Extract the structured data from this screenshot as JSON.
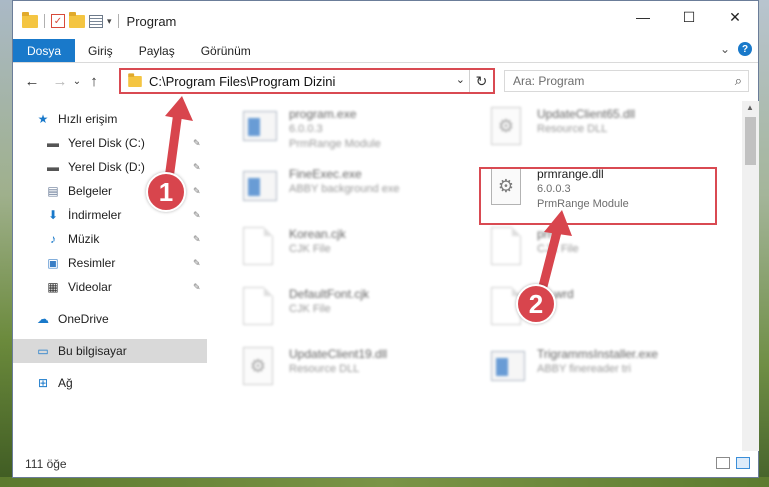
{
  "window": {
    "title": "Program",
    "min_glyph": "—",
    "max_glyph": "☐",
    "close_glyph": "✕"
  },
  "ribbon": {
    "tabs": [
      "Dosya",
      "Giriş",
      "Paylaş",
      "Görünüm"
    ],
    "expand_glyph": "⌄",
    "help_glyph": "?"
  },
  "navigation": {
    "back_glyph": "←",
    "forward_glyph": "→",
    "recent_glyph": "⌄",
    "up_glyph": "↑",
    "address": "C:\\Program Files\\Program Dizini",
    "address_dropdown_glyph": "⌄",
    "refresh_glyph": "↻",
    "search_placeholder": "Ara: Program",
    "search_glyph": "⌕"
  },
  "sidebar": {
    "items": [
      {
        "label": "Hızlı erişim",
        "icon": "star-icon",
        "glyph": "★",
        "color": "#1979ca",
        "pinned": false
      },
      {
        "label": "Yerel Disk (C:)",
        "icon": "drive-icon",
        "glyph": "▬",
        "color": "#555555",
        "pinned": true
      },
      {
        "label": "Yerel Disk (D:)",
        "icon": "drive-icon",
        "glyph": "▬",
        "color": "#555555",
        "pinned": true
      },
      {
        "label": "Belgeler",
        "icon": "documents-icon",
        "glyph": "▤",
        "color": "#6b7d99",
        "pinned": true
      },
      {
        "label": "İndirmeler",
        "icon": "download-icon",
        "glyph": "⬇",
        "color": "#1979ca",
        "pinned": true
      },
      {
        "label": "Müzik",
        "icon": "music-icon",
        "glyph": "♪",
        "color": "#1979ca",
        "pinned": true
      },
      {
        "label": "Resimler",
        "icon": "pictures-icon",
        "glyph": "▣",
        "color": "#3a7fc6",
        "pinned": true
      },
      {
        "label": "Videolar",
        "icon": "videos-icon",
        "glyph": "▦",
        "color": "#333333",
        "pinned": true
      },
      {
        "label": "OneDrive",
        "icon": "cloud-icon",
        "glyph": "☁",
        "color": "#1979ca",
        "pinned": false
      },
      {
        "label": "Bu bilgisayar",
        "icon": "computer-icon",
        "glyph": "▭",
        "color": "#1979ca",
        "pinned": false
      },
      {
        "label": "Ağ",
        "icon": "network-icon",
        "glyph": "⊞",
        "color": "#1979ca",
        "pinned": false
      }
    ],
    "pin_glyph": "📌"
  },
  "files": [
    {
      "name": "program.exe",
      "line2": "6.0.0.3",
      "line3": "PrmRange Module",
      "icon": "exe-icon"
    },
    {
      "name": "UpdateClient65.dll",
      "line2": "Resource DLL",
      "line3": "",
      "icon": "dll-icon"
    },
    {
      "name": "FineExec.exe",
      "line2": "ABBY background exe",
      "line3": "",
      "icon": "exe-icon"
    },
    {
      "name": "prmrange.dll",
      "line2": "6.0.0.3",
      "line3": "PrmRange Module",
      "icon": "dll-icon"
    },
    {
      "name": "Korean.cjk",
      "line2": "CJK File",
      "line3": "",
      "icon": "doc-icon"
    },
    {
      "name": "prm",
      "line2": "CJK File",
      "line3": "",
      "icon": "doc-icon"
    },
    {
      "name": "DefaultFont.cjk",
      "line2": "CJK File",
      "line3": "",
      "icon": "doc-icon"
    },
    {
      "name": "Ex.wrd",
      "line2": "File",
      "line3": "",
      "icon": "doc-icon"
    },
    {
      "name": "UpdateClient19.dll",
      "line2": "Resource DLL",
      "line3": "",
      "icon": "dll-icon"
    },
    {
      "name": "TrigrammsInstaller.exe",
      "line2": "ABBY finereader tri",
      "line3": "",
      "icon": "exe-icon"
    }
  ],
  "status": {
    "item_count": "111 öğe"
  },
  "callouts": [
    "1",
    "2"
  ],
  "colors": {
    "accent": "#1979ca",
    "highlight": "#d94a52"
  }
}
